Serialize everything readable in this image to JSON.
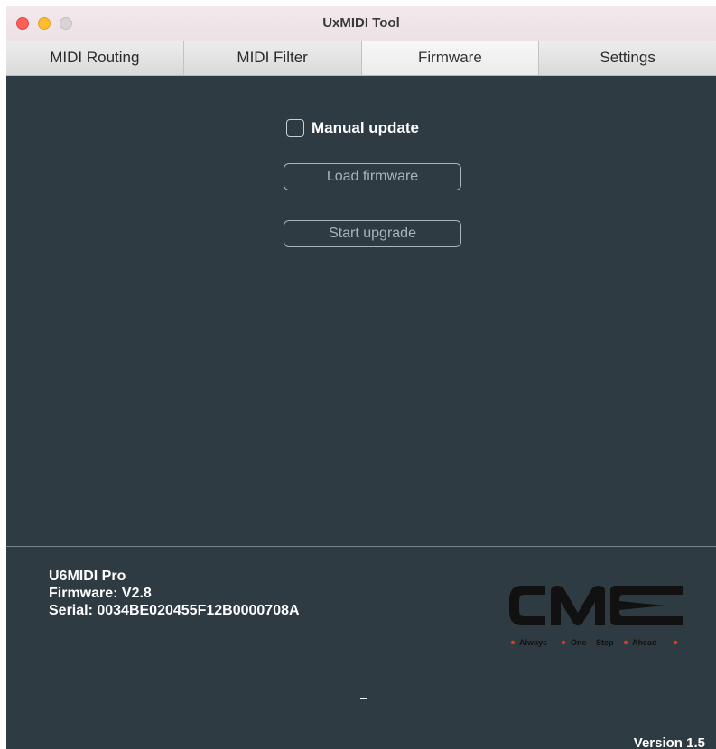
{
  "window": {
    "title": "UxMIDI Tool"
  },
  "tabs": [
    {
      "label": "MIDI Routing",
      "active": false
    },
    {
      "label": "MIDI Filter",
      "active": false
    },
    {
      "label": "Firmware",
      "active": true
    },
    {
      "label": "Settings",
      "active": false
    }
  ],
  "firmware": {
    "manual_update_label": "Manual update",
    "manual_update_checked": false,
    "load_button_label": "Load firmware",
    "start_button_label": "Start upgrade"
  },
  "device": {
    "name": "U6MIDI Pro",
    "firmware": "Firmware: V2.8",
    "serial": "Serial: 0034BE020455F12B0000708A"
  },
  "logo": {
    "text": "CME",
    "tagline": [
      "Always",
      "One",
      "Step",
      "Ahead"
    ]
  },
  "status": {
    "dash": "-",
    "version": "Version 1.5"
  },
  "colors": {
    "background": "#2f3b42",
    "logo_dark": "#111111",
    "logo_accent": "#d6401f"
  }
}
